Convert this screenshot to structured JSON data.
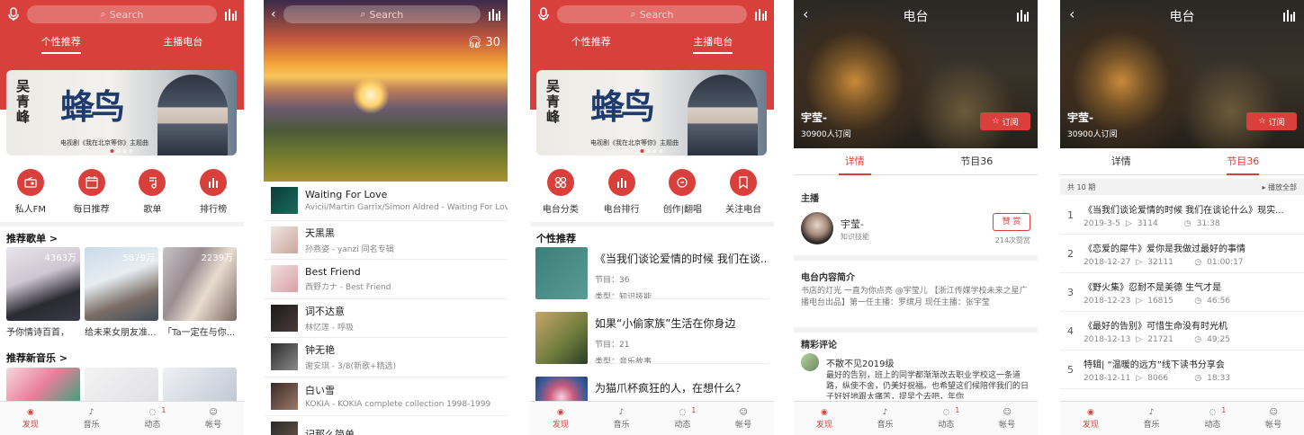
{
  "search_placeholder": "Search",
  "bottom_nav": [
    "发现",
    "音乐",
    "动态",
    "帐号"
  ],
  "dynamic_badge": "1",
  "screen1": {
    "tabs": [
      "个性推荐",
      "主播电台"
    ],
    "banner": {
      "artist": "吴青峰",
      "title": "蜂鸟",
      "caption": "电视剧《我在北京等你》主题曲"
    },
    "shortcuts": [
      "私人FM",
      "每日推荐",
      "歌单",
      "排行榜"
    ],
    "sec_playlists": "推荐歌单 >",
    "playlists": [
      {
        "count": "4363万",
        "caption": "予你情诗百首，"
      },
      {
        "count": "5879万",
        "caption": "给未来女朋友准..."
      },
      {
        "count": "2239万",
        "caption": "「Ta一定在与你..."
      }
    ],
    "sec_new_music": "推荐新音乐 >"
  },
  "screen2": {
    "listen_count": "30",
    "songs": [
      {
        "title": "Waiting For Love",
        "sub": "Avicii/Martin Garrix/Simon Aldred - Waiting For Love"
      },
      {
        "title": "天黑黑",
        "sub": "孙燕姿 - yanzi 同名专辑"
      },
      {
        "title": "Best Friend",
        "sub": "西野カナ - Best Friend"
      },
      {
        "title": "词不达意",
        "sub": "林忆莲 - 呼吸"
      },
      {
        "title": "钟无艳",
        "sub": "谢安琪 - 3/8(新歌+精选)"
      },
      {
        "title": "白い雪",
        "sub": "KOKIA - KOKIA complete collection 1998-1999"
      },
      {
        "title": "记那么简单",
        "sub": ""
      }
    ]
  },
  "screen3": {
    "tabs": [
      "个性推荐",
      "主播电台"
    ],
    "shortcuts": [
      "电台分类",
      "电台排行",
      "创作|翻唱",
      "关注电台"
    ],
    "sec_title": "个性推荐",
    "items": [
      {
        "title": "《当我们谈论爱情的时候 我们在谈...",
        "meta1": "节目：36",
        "meta2": "类型：知识技能"
      },
      {
        "title": "如果“小偷家族”生活在你身边",
        "meta1": "节目：21",
        "meta2": "类型：音乐故事"
      },
      {
        "title": "为猫爪杯疯狂的人，在想什么？",
        "meta1": "",
        "meta2": ""
      }
    ]
  },
  "screen4": {
    "title": "电台",
    "host_name": "宇莹-",
    "subscribers": "30900人订阅",
    "subscribe_btn": "订阅",
    "tabs": [
      "详情",
      "节目36"
    ],
    "host_label": "主播",
    "anchor_name": "宇莹-",
    "anchor_tag": "知识技能",
    "tip_btn": "赞 赏",
    "tip_count": "214次赞赏",
    "intro_label": "电台内容简介",
    "intro_text": "书店的灯光 一直为你点亮 @宇莹儿 【浙江传媒学校未来之星广播电台出品】第一任主播：罗缤月 现任主播：张宇莹",
    "comments_label": "精彩评论",
    "commenter": "不散不见2019级",
    "comment_text": "最好的告别，班上的同学都渐渐改去职业学校这一条道路，纵使不舍，仍美好祝福。也希望这们候陪伴我们的日子好好地跟太痛苦，提早个去吧，年你"
  },
  "screen5": {
    "title": "电台",
    "host_name": "宇莹-",
    "subscribers": "30900人订阅",
    "subscribe_btn": "订阅",
    "tabs": [
      "详情",
      "节目36"
    ],
    "total": "共 10 期",
    "sort": "播放全部",
    "programs": [
      {
        "no": "1",
        "title": "《当我们谈论爱情的时候 我们在谈论什么》现实...",
        "date": "2019-3-5",
        "plays": "3114",
        "dur": "31:38"
      },
      {
        "no": "2",
        "title": "《恋爱的犀牛》爱你是我做过最好的事情",
        "date": "2018-12-27",
        "plays": "32111",
        "dur": "01:00:17"
      },
      {
        "no": "3",
        "title": "《野火集》忍耐不是美德 生气才是",
        "date": "2018-12-23",
        "plays": "16815",
        "dur": "46:56"
      },
      {
        "no": "4",
        "title": "《最好的告别》可惜生命没有时光机",
        "date": "2018-12-13",
        "plays": "21721",
        "dur": "49:25"
      },
      {
        "no": "5",
        "title": "特辑| “温暖的远方”线下读书分享会",
        "date": "2018-12-11",
        "plays": "8066",
        "dur": "18:33"
      }
    ]
  }
}
